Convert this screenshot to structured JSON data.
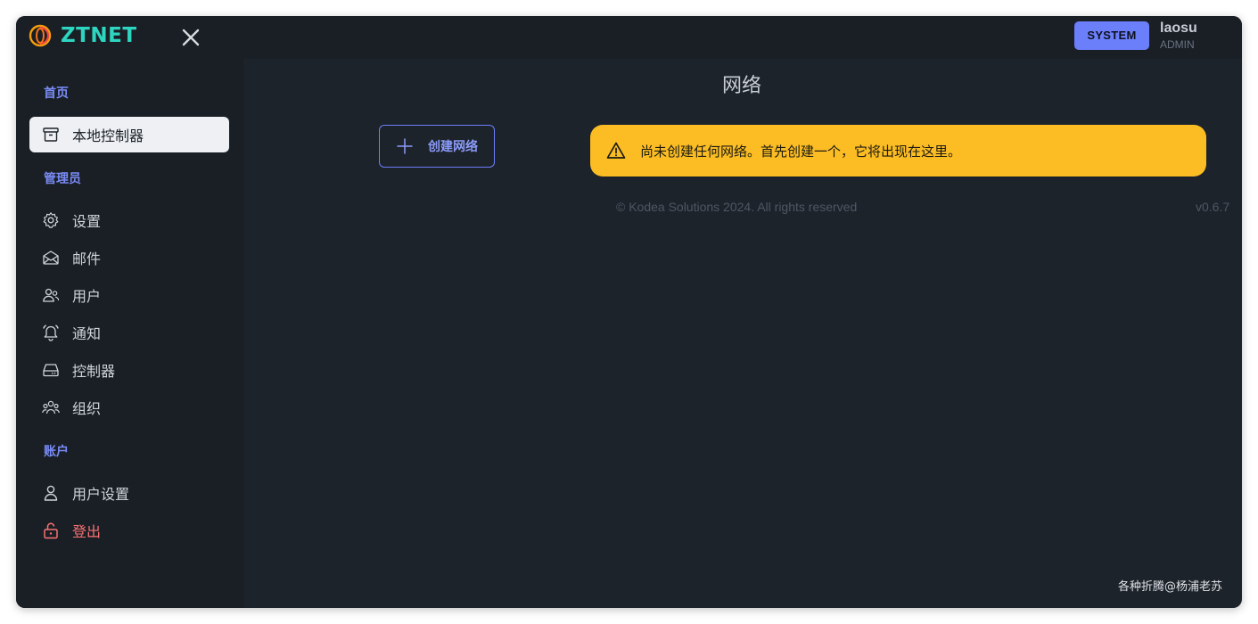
{
  "app": {
    "logo_text": "ZTNET",
    "brand_color": "#2dd4bf",
    "accent_color": "#6c7ffb"
  },
  "topbar": {
    "system_badge": "SYSTEM",
    "user_name": "laosu",
    "user_role": "ADMIN",
    "close_icon": "close-icon"
  },
  "sidebar": {
    "sections": [
      {
        "title": "首页",
        "items": [
          {
            "label": "本地控制器",
            "icon": "archive-box-icon",
            "active": true
          }
        ]
      },
      {
        "title": "管理员",
        "items": [
          {
            "label": "设置",
            "icon": "gear-icon"
          },
          {
            "label": "邮件",
            "icon": "envelope-open-icon"
          },
          {
            "label": "用户",
            "icon": "users-icon"
          },
          {
            "label": "通知",
            "icon": "bell-icon"
          },
          {
            "label": "控制器",
            "icon": "server-icon"
          },
          {
            "label": "组织",
            "icon": "user-group-icon"
          }
        ]
      },
      {
        "title": "账户",
        "items": [
          {
            "label": "用户设置",
            "icon": "user-icon"
          },
          {
            "label": "登出",
            "icon": "unlock-icon",
            "color": "#f87272"
          }
        ]
      }
    ]
  },
  "main": {
    "title": "网络",
    "create_button_label": "创建网络",
    "alert_text": "尚未创建任何网络。首先创建一个，它将出现在这里。",
    "alert_color": "#fbbd23"
  },
  "footer": {
    "copyright": "© Kodea Solutions 2024. All rights reserved",
    "version": "v0.6.7"
  },
  "watermark": "各种折腾@杨浦老苏"
}
